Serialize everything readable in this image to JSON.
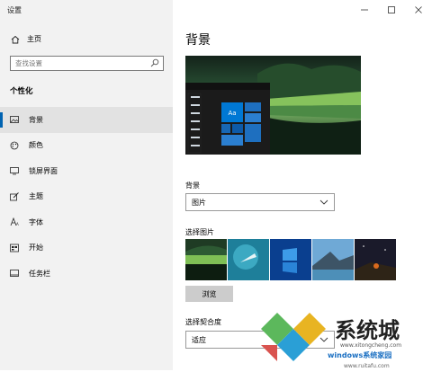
{
  "window": {
    "title": "设置"
  },
  "sidebar": {
    "home_label": "主页",
    "search_placeholder": "查找设置",
    "section_title": "个性化",
    "items": [
      {
        "label": "背景",
        "icon": "image-icon",
        "active": true
      },
      {
        "label": "颜色",
        "icon": "palette-icon",
        "active": false
      },
      {
        "label": "锁屏界面",
        "icon": "lock-screen-icon",
        "active": false
      },
      {
        "label": "主题",
        "icon": "brush-icon",
        "active": false
      },
      {
        "label": "字体",
        "icon": "font-icon",
        "active": false
      },
      {
        "label": "开始",
        "icon": "start-icon",
        "active": false
      },
      {
        "label": "任务栏",
        "icon": "taskbar-icon",
        "active": false
      }
    ]
  },
  "main": {
    "title": "背景",
    "preview_tile_text": "Aa",
    "background_label": "背景",
    "background_value": "图片",
    "choose_picture_label": "选择图片",
    "browse_label": "浏览",
    "fit_label": "选择契合度",
    "fit_value": "适应"
  },
  "watermark": {
    "brand_text": "系统城",
    "url_text": "www.xitongcheng.com",
    "windows_text": "windows系统家园",
    "site_text": "www.ruitafu.com"
  },
  "colors": {
    "accent": "#0063b1",
    "sidebar_bg": "#f2f2f2"
  }
}
